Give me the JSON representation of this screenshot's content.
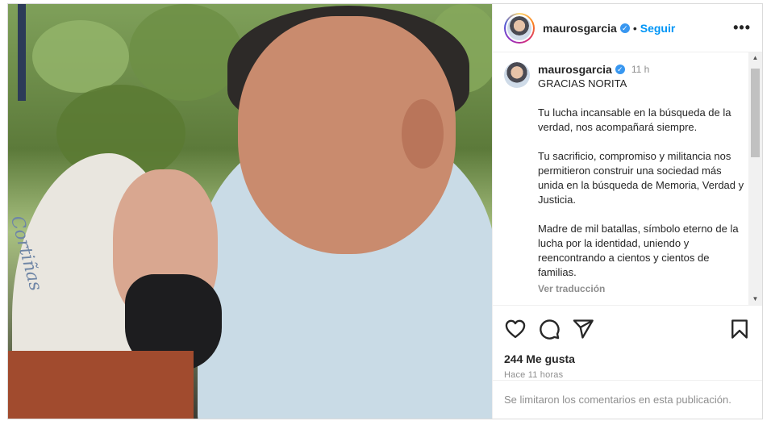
{
  "post": {
    "username": "maurosgarcia",
    "verified_icon": "verified-badge-icon",
    "follow_label": "Seguir",
    "more_label": "•••",
    "photo_scarf_text": "Cortiñas"
  },
  "caption": {
    "username": "maurosgarcia",
    "time": "11 h",
    "title": "GRACIAS NORITA",
    "p1": "Tu lucha incansable en la búsqueda de la verdad, nos acompañará siempre.",
    "p2": "Tu sacrificio, compromiso y militancia nos permitieron construir una sociedad más unida en la búsqueda de Memoria, Verdad y Justicia.",
    "p3": "Madre de mil batallas, símbolo eterno de la lucha por la identidad, uniendo y reencontrando a cientos y cientos de familias.",
    "translate": "Ver traducción"
  },
  "actions": {
    "like_icon": "heart-icon",
    "comment_icon": "comment-icon",
    "share_icon": "send-icon",
    "save_icon": "bookmark-icon"
  },
  "stats": {
    "likes": "244 Me gusta",
    "posted": "Hace 11 horas"
  },
  "footer": {
    "comments_off": "Se limitaron los comentarios en esta publicación."
  },
  "colors": {
    "link_blue": "#0095f6",
    "verified_blue": "#3897f0",
    "muted": "#8e8e8e"
  }
}
